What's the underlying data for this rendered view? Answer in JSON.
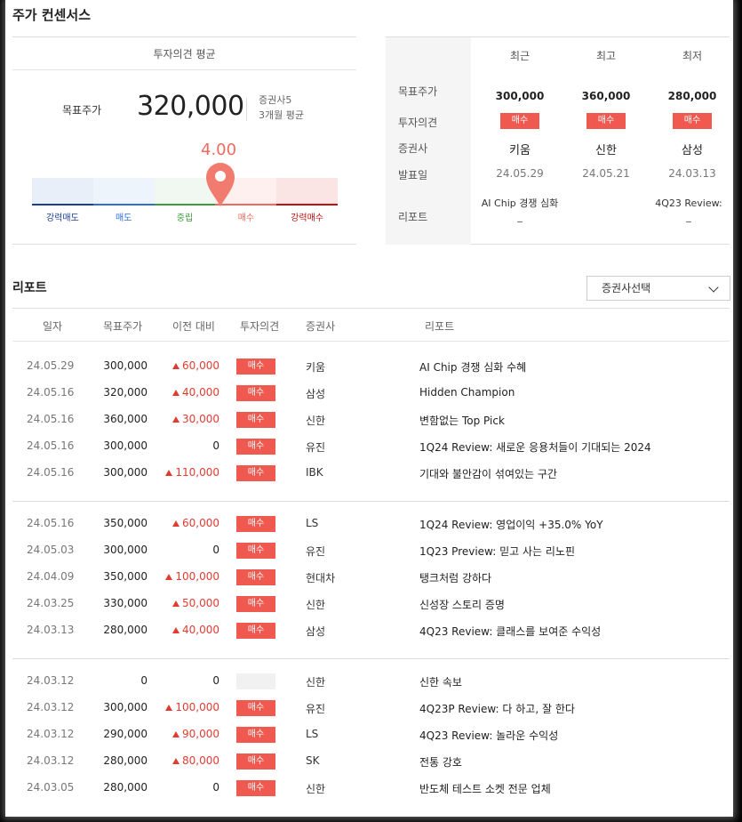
{
  "page": {
    "title": "주가 컨센서스"
  },
  "consensus": {
    "header": "투자의견 평균",
    "target_label": "목표주가",
    "target_value": "320,000",
    "broker_count": "증권사5",
    "period": "3개월 평균",
    "score": "4.00",
    "gauge_labels": [
      "강력매도",
      "매도",
      "중립",
      "매수",
      "강력매수"
    ],
    "gauge_colors": {
      "strong_sell": "#1a3f8f",
      "sell": "#2e6fd1",
      "neutral": "#3c9c3c",
      "buy": "#f06a5e",
      "strong_buy": "#c01010"
    }
  },
  "summary": {
    "columns": [
      "최근",
      "최고",
      "최저"
    ],
    "row_labels": [
      "목표주가",
      "투자의견",
      "증권사",
      "발표일",
      "리포트"
    ],
    "recent": {
      "target": "300,000",
      "opinion": "매수",
      "broker": "키움",
      "date": "24.05.29",
      "report": "AI Chip 경쟁 심화_"
    },
    "high": {
      "target": "360,000",
      "opinion": "매수",
      "broker": "신한",
      "date": "24.05.21",
      "report": ""
    },
    "low": {
      "target": "280,000",
      "opinion": "매수",
      "broker": "삼성",
      "date": "24.03.13",
      "report": "4Q23 Review: _"
    }
  },
  "reports": {
    "title": "리포트",
    "select_label": "증권사선택",
    "headers": [
      "일자",
      "목표주가",
      "이전 대비",
      "투자의견",
      "증권사",
      "리포트"
    ],
    "groups": [
      [
        {
          "date": "24.05.29",
          "target": "300,000",
          "change": "60,000",
          "dir": "up",
          "op": "매수",
          "broker": "키움",
          "report": "AI Chip 경쟁 심화 수혜"
        },
        {
          "date": "24.05.16",
          "target": "320,000",
          "change": "40,000",
          "dir": "up",
          "op": "매수",
          "broker": "삼성",
          "report": "Hidden Champion"
        },
        {
          "date": "24.05.16",
          "target": "360,000",
          "change": "30,000",
          "dir": "up",
          "op": "매수",
          "broker": "신한",
          "report": "변함없는 Top Pick"
        },
        {
          "date": "24.05.16",
          "target": "300,000",
          "change": "0",
          "dir": "zero",
          "op": "매수",
          "broker": "유진",
          "report": "1Q24 Review: 새로운 응용처들이 기대되는 2024"
        },
        {
          "date": "24.05.16",
          "target": "300,000",
          "change": "110,000",
          "dir": "up",
          "op": "매수",
          "broker": "IBK",
          "report": "기대와 불안감이 섞여있는 구간"
        }
      ],
      [
        {
          "date": "24.05.16",
          "target": "350,000",
          "change": "60,000",
          "dir": "up",
          "op": "매수",
          "broker": "LS",
          "report": "1Q24 Review: 영업이익 +35.0% YoY"
        },
        {
          "date": "24.05.03",
          "target": "300,000",
          "change": "0",
          "dir": "zero",
          "op": "매수",
          "broker": "유진",
          "report": "1Q23 Preview: 믿고 사는 리노핀"
        },
        {
          "date": "24.04.09",
          "target": "350,000",
          "change": "100,000",
          "dir": "up",
          "op": "매수",
          "broker": "현대차",
          "report": "탱크처럼 강하다"
        },
        {
          "date": "24.03.25",
          "target": "330,000",
          "change": "50,000",
          "dir": "up",
          "op": "매수",
          "broker": "신한",
          "report": "신성장 스토리 증명"
        },
        {
          "date": "24.03.13",
          "target": "280,000",
          "change": "40,000",
          "dir": "up",
          "op": "매수",
          "broker": "삼성",
          "report": "4Q23 Review: 클래스를 보여준 수익성"
        }
      ],
      [
        {
          "date": "24.03.12",
          "target": "0",
          "change": "0",
          "dir": "zero",
          "op": "",
          "broker": "신한",
          "report": "신한 속보"
        },
        {
          "date": "24.03.12",
          "target": "300,000",
          "change": "100,000",
          "dir": "up",
          "op": "매수",
          "broker": "유진",
          "report": "4Q23P Review: 다 하고, 잘 한다"
        },
        {
          "date": "24.03.12",
          "target": "290,000",
          "change": "90,000",
          "dir": "up",
          "op": "매수",
          "broker": "LS",
          "report": "4Q23 Review: 놀라운 수익성"
        },
        {
          "date": "24.03.12",
          "target": "280,000",
          "change": "80,000",
          "dir": "up",
          "op": "매수",
          "broker": "SK",
          "report": "전통 강호"
        },
        {
          "date": "24.03.05",
          "target": "280,000",
          "change": "0",
          "dir": "zero",
          "op": "매수",
          "broker": "신한",
          "report": "반도체 테스트 소켓 전문 업체"
        }
      ]
    ]
  }
}
